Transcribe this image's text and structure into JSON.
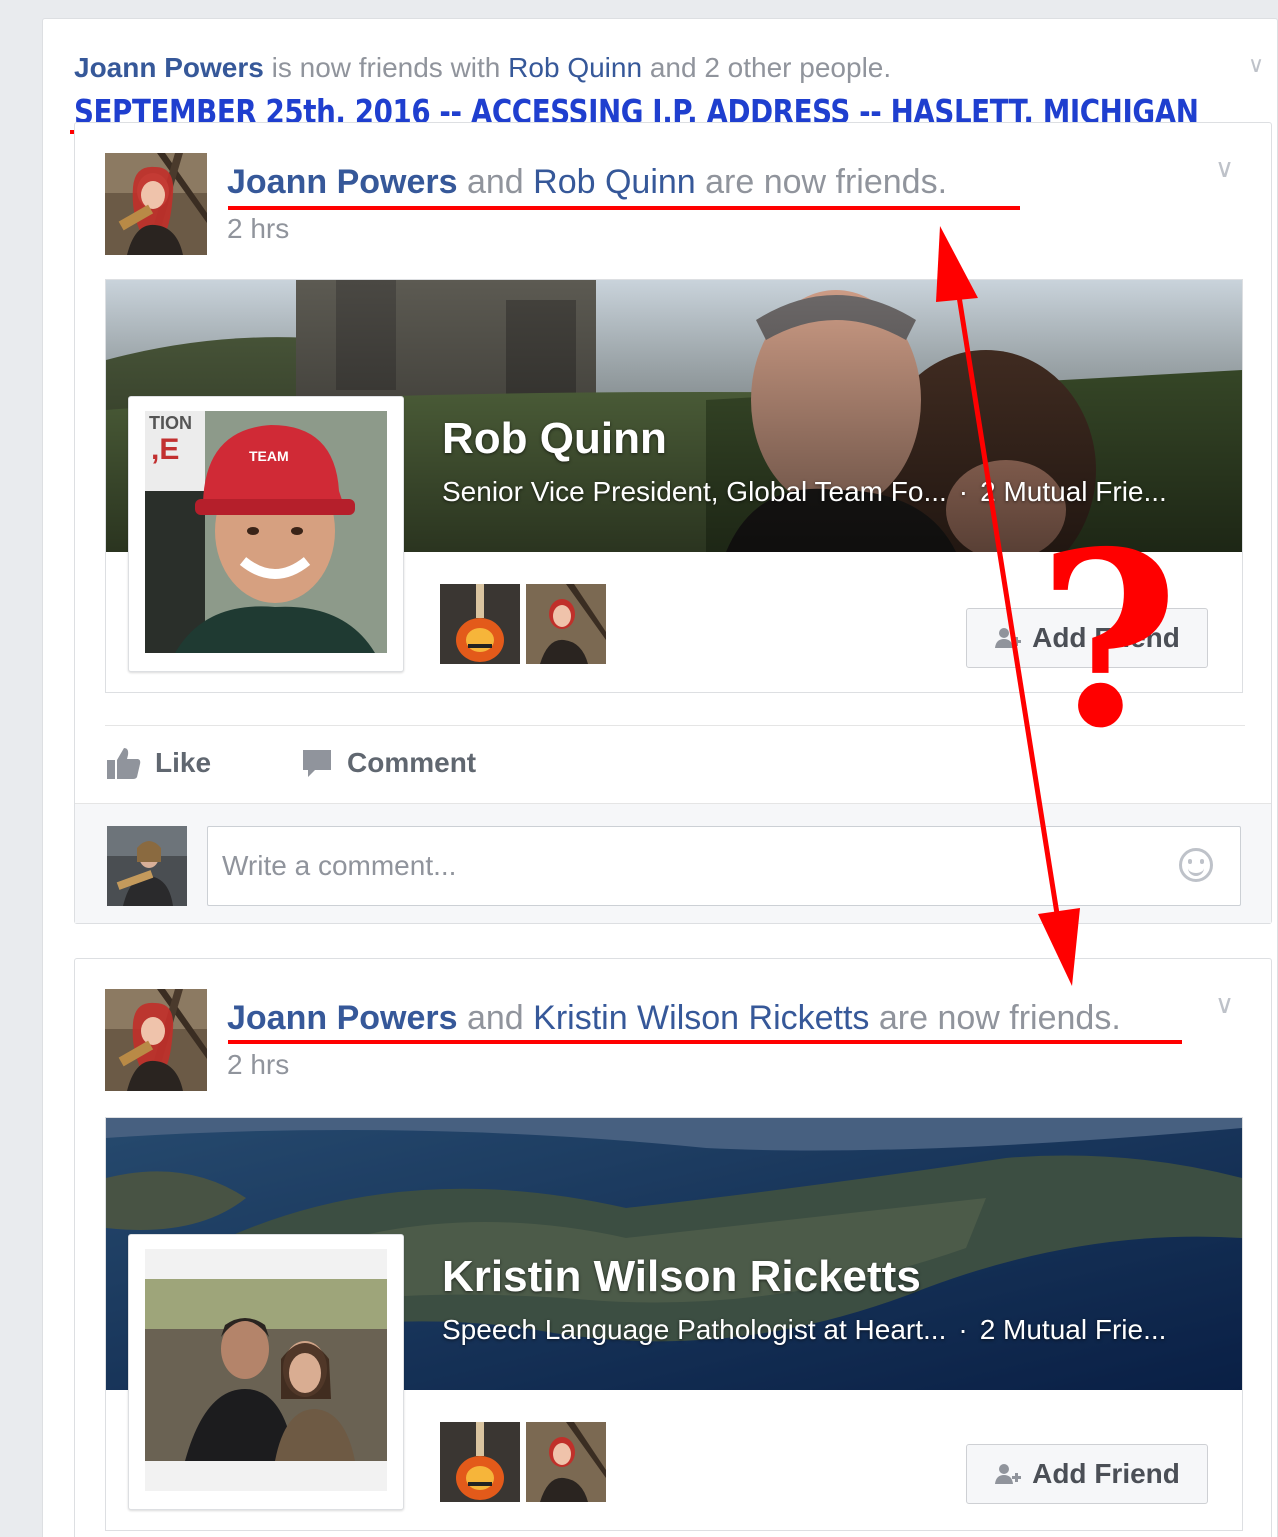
{
  "story": {
    "actor": "Joann Powers",
    "text_mid": " is now friends with ",
    "friend": "Rob Quinn",
    "text_end": " and 2 other people."
  },
  "annotation": {
    "title": "SEPTEMBER 25th, 2016 -- ACCESSING  I.P. ADDRESS -- HASLETT, MICHIGAN",
    "question_mark": "?",
    "color": "#ff0000"
  },
  "posts": [
    {
      "actor": "Joann Powers",
      "connector": " and ",
      "friend": "Rob Quinn",
      "suffix": " are now friends.",
      "time": "2 hrs",
      "card": {
        "name": "Rob Quinn",
        "subtitle": "Senior Vice President, Global Team Fo...",
        "separator": "·",
        "mutual": "2 Mutual Frie...",
        "add_friend_label": "Add Friend"
      }
    },
    {
      "actor": "Joann Powers",
      "connector": " and ",
      "friend": "Kristin Wilson Ricketts",
      "suffix": " are now friends.",
      "time": "2 hrs",
      "card": {
        "name": "Kristin Wilson Ricketts",
        "subtitle": "Speech Language Pathologist at Heart...",
        "separator": "·",
        "mutual": "2 Mutual Frie...",
        "add_friend_label": "Add Friend"
      }
    }
  ],
  "actions": {
    "like": "Like",
    "comment": "Comment"
  },
  "comment_box": {
    "placeholder": "Write a comment..."
  },
  "colors": {
    "link": "#365899",
    "muted": "#90949c",
    "annotation_blue": "#1f3fcf",
    "annotation_red": "#ff0000"
  }
}
